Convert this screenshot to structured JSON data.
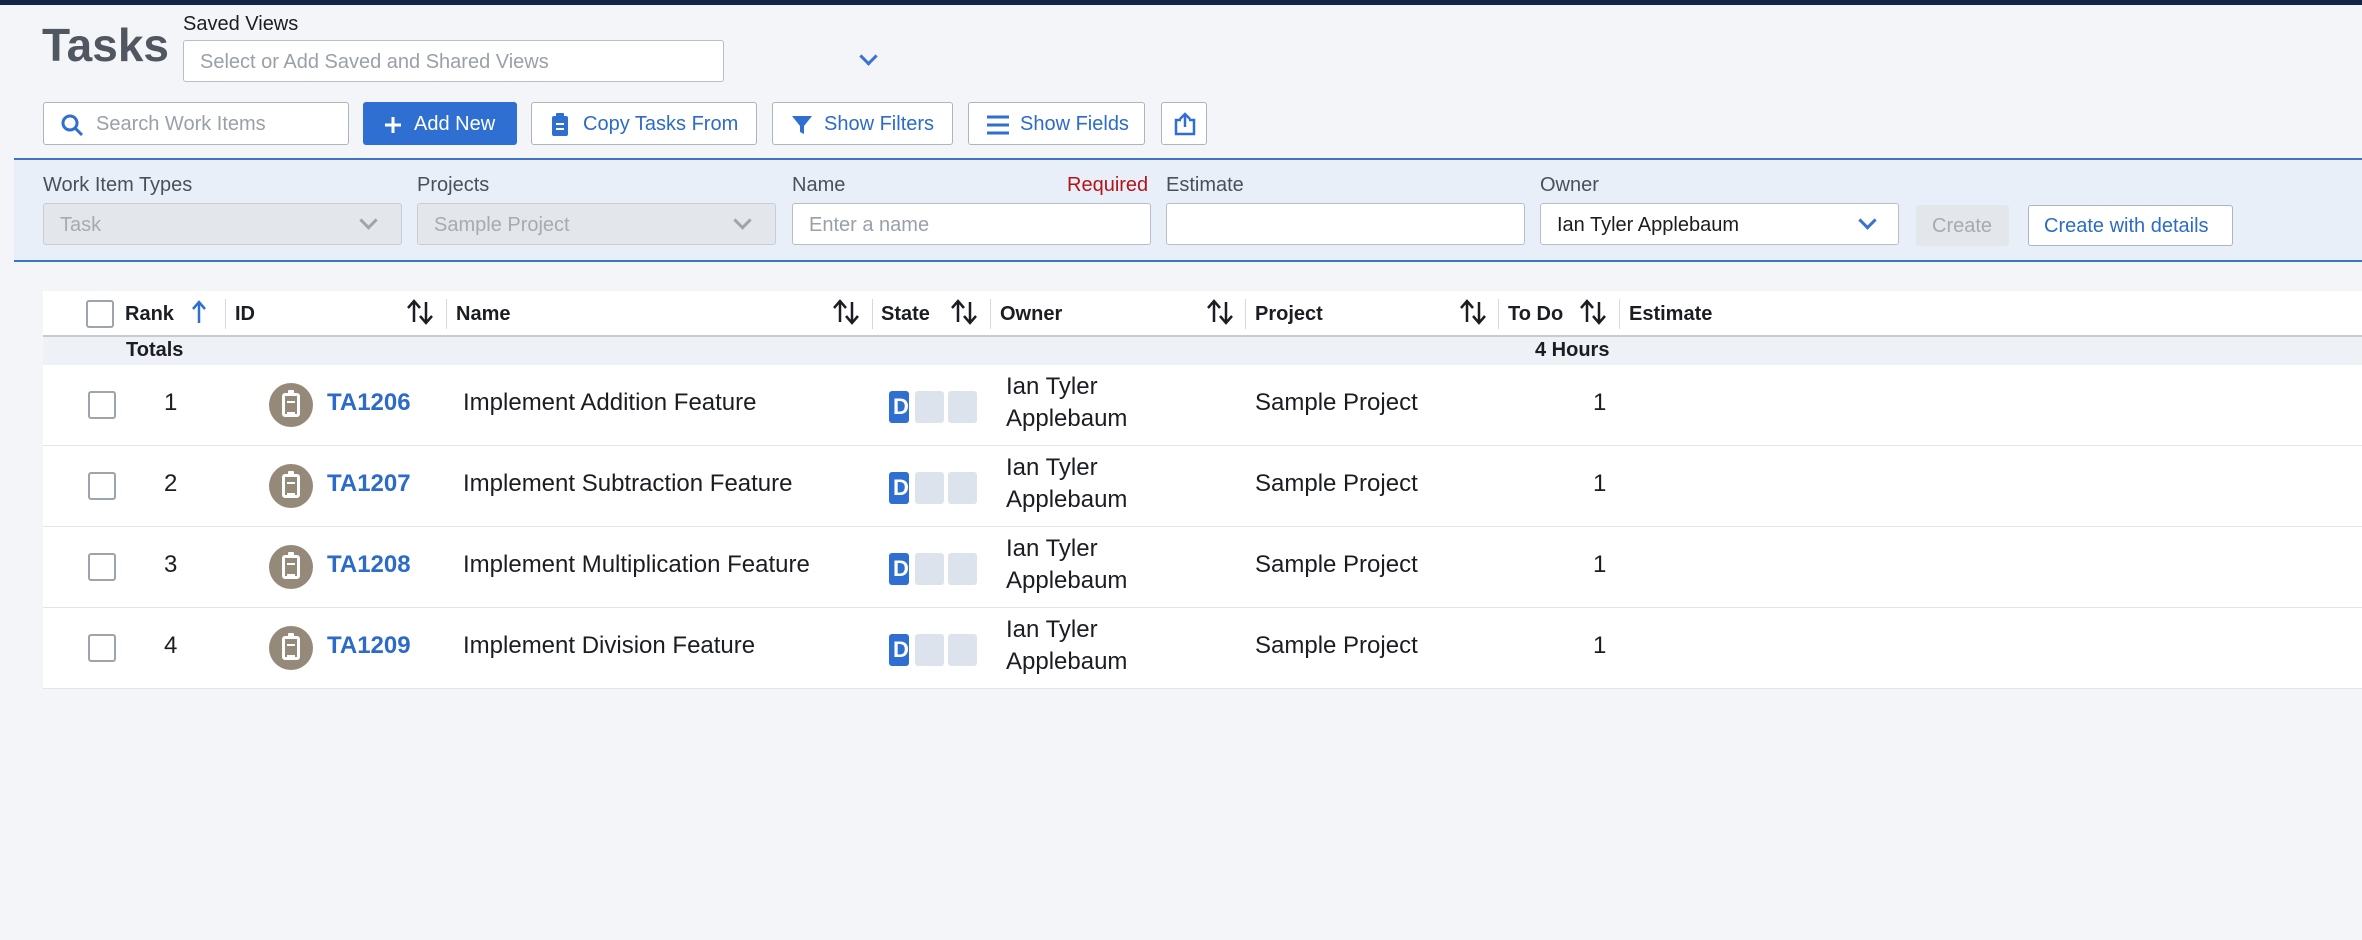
{
  "page": {
    "title": "Tasks"
  },
  "saved_views": {
    "label": "Saved Views",
    "placeholder": "Select or Add Saved and Shared Views"
  },
  "toolbar": {
    "search_placeholder": "Search Work Items",
    "add_new": "Add New",
    "copy_tasks": "Copy Tasks From",
    "show_filters": "Show Filters",
    "show_fields": "Show Fields"
  },
  "create_bar": {
    "work_item_types_label": "Work Item Types",
    "work_item_types_value": "Task",
    "projects_label": "Projects",
    "projects_value": "Sample Project",
    "name_label": "Name",
    "name_required": "Required",
    "name_placeholder": "Enter a name",
    "estimate_label": "Estimate",
    "owner_label": "Owner",
    "owner_value": "Ian Tyler Applebaum",
    "create": "Create",
    "create_with_details": "Create with details"
  },
  "grid": {
    "columns": [
      "Rank",
      "ID",
      "Name",
      "State",
      "Owner",
      "Project",
      "To Do",
      "Estimate"
    ],
    "totals_label": "Totals",
    "totals_todo": "4 Hours",
    "rows": [
      {
        "rank": "1",
        "id": "TA1206",
        "name": "Implement Addition Feature",
        "state": "D",
        "owner_line1": "Ian Tyler",
        "owner_line2": "Applebaum",
        "project": "Sample Project",
        "todo": "1"
      },
      {
        "rank": "2",
        "id": "TA1207",
        "name": "Implement Subtraction Feature",
        "state": "D",
        "owner_line1": "Ian Tyler",
        "owner_line2": "Applebaum",
        "project": "Sample Project",
        "todo": "1"
      },
      {
        "rank": "3",
        "id": "TA1208",
        "name": "Implement Multiplication Feature",
        "state": "D",
        "owner_line1": "Ian Tyler",
        "owner_line2": "Applebaum",
        "project": "Sample Project",
        "todo": "1"
      },
      {
        "rank": "4",
        "id": "TA1209",
        "name": "Implement Division Feature",
        "state": "D",
        "owner_line1": "Ian Tyler",
        "owner_line2": "Applebaum",
        "project": "Sample Project",
        "todo": "1"
      }
    ]
  },
  "icons": {
    "search": "search-icon",
    "add": "plus-icon",
    "copy": "clipboard-icon",
    "filter": "filter-icon",
    "fields": "list-icon",
    "export": "export-icon",
    "sort": "sort-icon",
    "task": "task-icon"
  },
  "colors": {
    "accent": "#2f6fd1",
    "topbar": "#13264a",
    "required": "#b3141a",
    "task_icon": "#958a79"
  }
}
